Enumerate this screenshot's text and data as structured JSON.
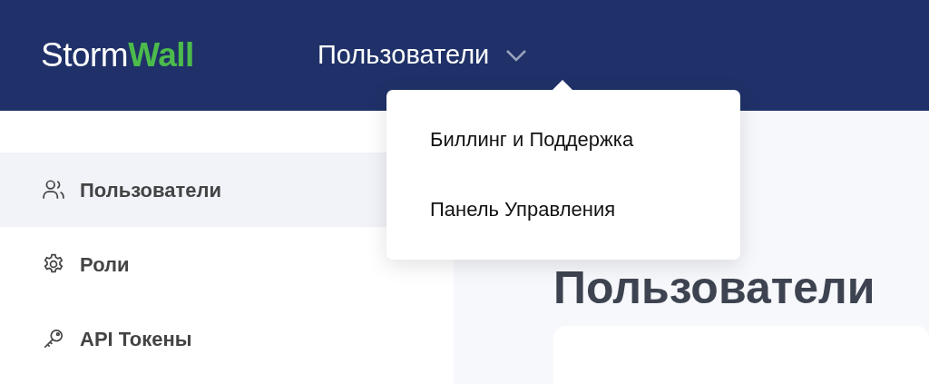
{
  "header": {
    "logo": {
      "light": "Storm",
      "accent": "Wall"
    },
    "nav": {
      "label": "Пользователи",
      "expanded": true
    },
    "dropdown": [
      {
        "label": "Биллинг и Поддержка"
      },
      {
        "label": "Панель Управления"
      }
    ]
  },
  "sidebar": {
    "items": [
      {
        "kind": "users",
        "label": "Пользователи",
        "selected": true
      },
      {
        "kind": "gear",
        "label": "Роли",
        "selected": false
      },
      {
        "kind": "key",
        "label": "API Токены",
        "selected": false
      }
    ]
  },
  "main": {
    "heading": "Пользователи"
  }
}
